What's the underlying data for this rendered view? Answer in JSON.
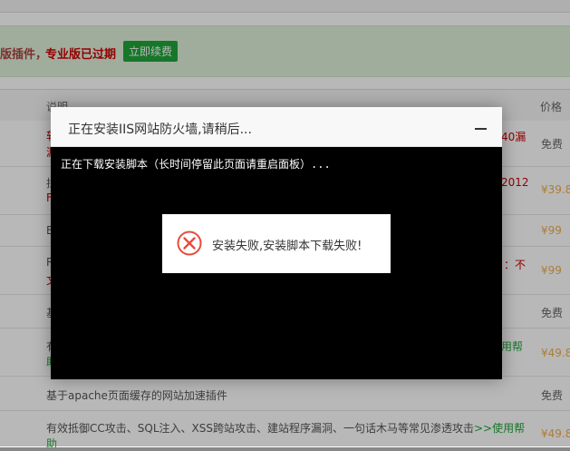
{
  "banner": {
    "text_left": "版插件，",
    "text_expired": "专业版已过期",
    "renew_button": "立即续费"
  },
  "table": {
    "col_desc": "说明",
    "col_price": "价格",
    "rows": [
      {
        "desc": "",
        "desc_right": "40漏",
        "price": "免费"
      },
      {
        "desc": "",
        "desc_right": "2012",
        "price": "¥39.8"
      },
      {
        "desc": "",
        "desc_right": "",
        "price": "¥99"
      },
      {
        "desc": "",
        "desc_right": "：不",
        "price": "¥99"
      },
      {
        "desc": "",
        "desc_right": "",
        "price": "免费"
      },
      {
        "desc": "",
        "desc_right": "用帮",
        "price": "¥49.8"
      },
      {
        "desc": "基于apache页面缓存的网站加速插件",
        "desc_right": "",
        "price": "免费"
      },
      {
        "desc": "有效抵御CC攻击、SQL注入、XSS跨站攻击、建站程序漏洞、一句话木马等常见渗透攻击",
        "link": ">>使用帮",
        "line2": "助",
        "price": "¥49.8"
      }
    ]
  },
  "dialog": {
    "title": "正在安装IIS网站防火墙,请稍后...",
    "console_text": "正在下载安装脚本（长时间停留此页面请重启面板）...",
    "toast_message": "安装失败,安装脚本下载失败!"
  },
  "colors": {
    "accent_green": "#20a53a",
    "error_red": "#e74c3c",
    "price_orange": "#f0ad4e"
  }
}
